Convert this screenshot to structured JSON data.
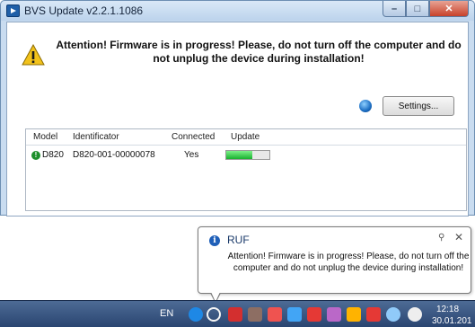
{
  "window": {
    "title": "BVS Update v2.2.1.1086",
    "close_glyph": "✕",
    "minimize_glyph": "–",
    "maximize_glyph": "□"
  },
  "attention_message": "Attention! Firmware is in progress!  Please, do not turn off the computer and do not unplug the device during installation!",
  "settings_label": "Settings...",
  "device_table": {
    "columns": [
      "Model",
      "Identificator",
      "Connected",
      "Update"
    ],
    "rows": [
      {
        "status_glyph": "!",
        "model": "D820",
        "identificator": "D820-001-00000078",
        "connected": "Yes",
        "update_progress": 0.6
      }
    ]
  },
  "notification": {
    "title": "RUF",
    "message": "Attention! Firmware is in progress!  Please, do not turn off the computer and do not unplug the device during installation!",
    "options_glyph": "⚲",
    "close_glyph": "✕"
  },
  "taskbar": {
    "language": "EN",
    "time": "12:18",
    "date": "30.01.201",
    "tray_icons": [
      "skype-icon",
      "update-icon",
      "pdf-icon",
      "app-icon",
      "network-tool-icon",
      "grid-icon",
      "arrow-icon",
      "chat-icon",
      "shield-icon",
      "flag-icon",
      "network-icon",
      "volume-icon"
    ]
  },
  "colors": {
    "accent": "#1f5fa8",
    "progress": "#18b12e",
    "status_ok": "#1d8f2c",
    "close_button": "#c7412a"
  }
}
